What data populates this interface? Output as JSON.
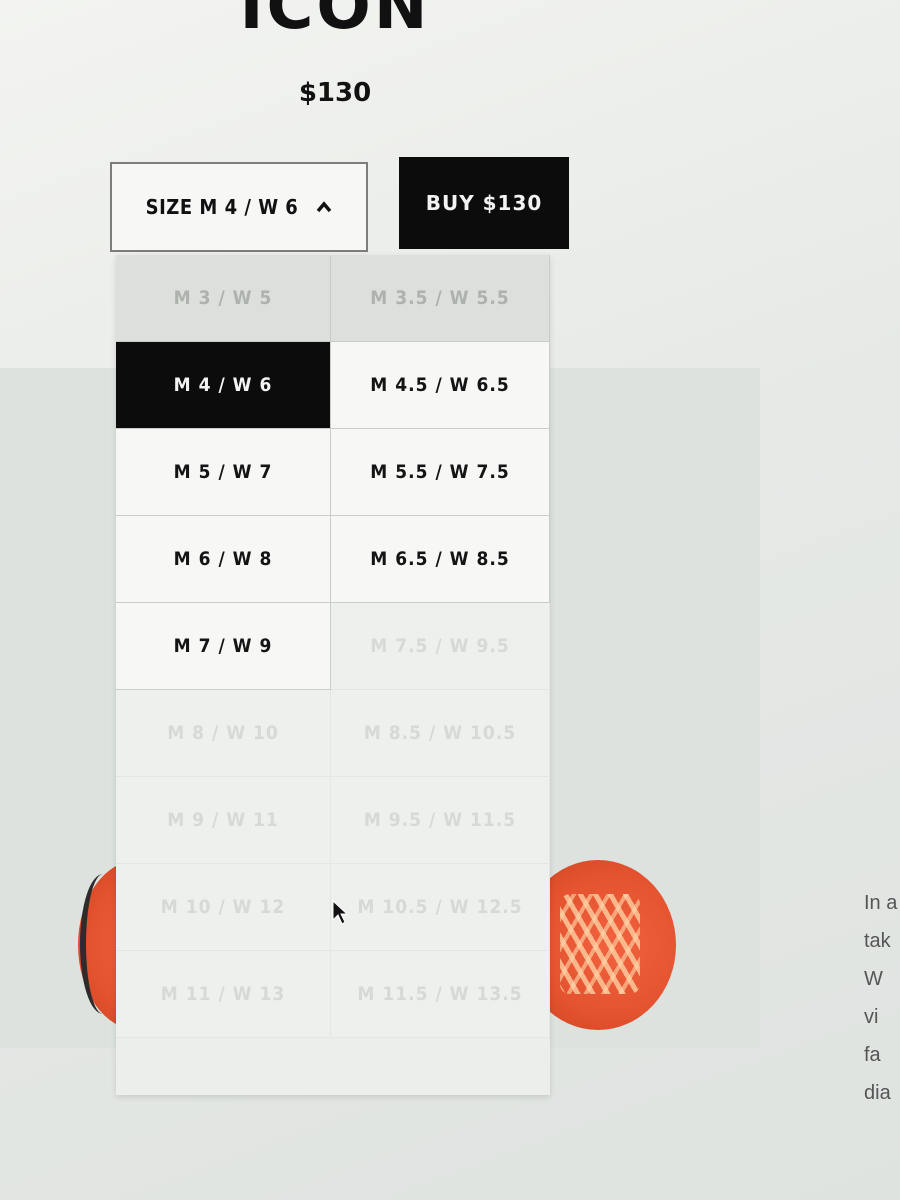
{
  "product": {
    "title": "\"ICON\"",
    "price": "$130"
  },
  "size_selector": {
    "label": "SIZE M 4 / W 6",
    "icon": "chevron-up-icon",
    "expanded": true
  },
  "buy_button": {
    "label": "BUY $130"
  },
  "size_options": [
    {
      "label": "M 3 / W 5",
      "state": "unavailable"
    },
    {
      "label": "M 3.5 / W 5.5",
      "state": "unavailable"
    },
    {
      "label": "M 4 / W 6",
      "state": "selected"
    },
    {
      "label": "M 4.5 / W 6.5",
      "state": "available"
    },
    {
      "label": "M 5 / W 7",
      "state": "available"
    },
    {
      "label": "M 5.5 / W 7.5",
      "state": "available"
    },
    {
      "label": "M 6 / W 8",
      "state": "available"
    },
    {
      "label": "M 6.5 / W 8.5",
      "state": "available"
    },
    {
      "label": "M 7 / W 9",
      "state": "available"
    },
    {
      "label": "M 7.5 / W 9.5",
      "state": "faded"
    },
    {
      "label": "M 8 / W 10",
      "state": "faded"
    },
    {
      "label": "M 8.5 / W 10.5",
      "state": "faded"
    },
    {
      "label": "M 9 / W 11",
      "state": "faded"
    },
    {
      "label": "M 9.5 / W 11.5",
      "state": "faded"
    },
    {
      "label": "M 10 / W 12",
      "state": "faded"
    },
    {
      "label": "M 10.5 / W 12.5",
      "state": "faded"
    },
    {
      "label": "M 11 / W 13",
      "state": "faded"
    },
    {
      "label": "M 11.5 / W 13.5",
      "state": "faded"
    }
  ],
  "description_fragment": [
    "In a",
    "tak",
    "W",
    "vi",
    "fa",
    "dia"
  ],
  "colors": {
    "selected_bg": "#0c0c0c",
    "button_bg": "#0c0c0c",
    "shoe_sole": "#e4522f"
  }
}
